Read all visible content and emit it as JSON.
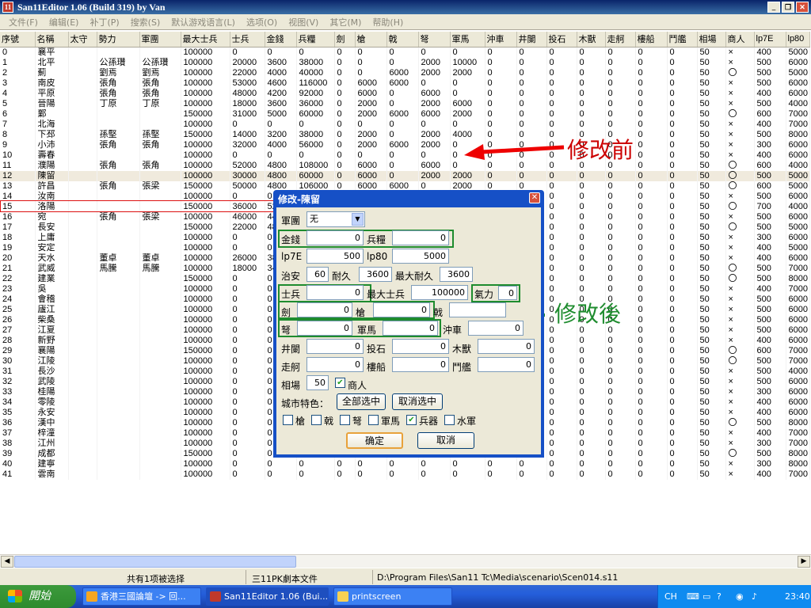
{
  "window": {
    "title": "San11Editor 1.06 (Build 319) by Van",
    "icon": "11"
  },
  "menu": [
    "文件(F)",
    "编辑(E)",
    "补丁(P)",
    "搜索(S)",
    "默认游戏语言(L)",
    "选项(O)",
    "视图(V)",
    "其它(M)",
    "帮助(H)"
  ],
  "columns": [
    "序號",
    "名稱",
    "太守",
    "勢力",
    "軍團",
    "最大士兵",
    "士兵",
    "金錢",
    "兵糧",
    "劍",
    "槍",
    "戟",
    "弩",
    "軍馬",
    "沖車",
    "井闌",
    "投石",
    "木獸",
    "走舸",
    "樓船",
    "鬥艦",
    "相場",
    "商人",
    "lp7E",
    "lp80"
  ],
  "rows": [
    [
      "0",
      "襄平",
      "",
      "",
      "",
      "100000",
      "0",
      "0",
      "0",
      "0",
      "0",
      "0",
      "0",
      "0",
      "0",
      "0",
      "0",
      "0",
      "0",
      "0",
      "0",
      "50",
      "×",
      "400",
      "5000"
    ],
    [
      "1",
      "北平",
      "",
      "公孫瓚",
      "公孫瓚",
      "100000",
      "20000",
      "3600",
      "38000",
      "0",
      "0",
      "0",
      "2000",
      "10000",
      "0",
      "0",
      "0",
      "0",
      "0",
      "0",
      "0",
      "50",
      "×",
      "500",
      "6000"
    ],
    [
      "2",
      "薊",
      "",
      "劉焉",
      "劉焉",
      "100000",
      "22000",
      "4000",
      "40000",
      "0",
      "0",
      "6000",
      "2000",
      "2000",
      "0",
      "0",
      "0",
      "0",
      "0",
      "0",
      "0",
      "50",
      "〇",
      "500",
      "5000"
    ],
    [
      "3",
      "南皮",
      "",
      "張角",
      "張角",
      "100000",
      "53000",
      "4600",
      "116000",
      "0",
      "6000",
      "6000",
      "0",
      "0",
      "0",
      "0",
      "0",
      "0",
      "0",
      "0",
      "0",
      "50",
      "×",
      "500",
      "6000"
    ],
    [
      "4",
      "平原",
      "",
      "張角",
      "張角",
      "100000",
      "48000",
      "4200",
      "92000",
      "0",
      "6000",
      "0",
      "6000",
      "0",
      "0",
      "0",
      "0",
      "0",
      "0",
      "0",
      "0",
      "50",
      "×",
      "400",
      "6000"
    ],
    [
      "5",
      "晉陽",
      "",
      "丁原",
      "丁原",
      "100000",
      "18000",
      "3600",
      "36000",
      "0",
      "2000",
      "0",
      "2000",
      "6000",
      "0",
      "0",
      "0",
      "0",
      "0",
      "0",
      "0",
      "50",
      "×",
      "500",
      "4000"
    ],
    [
      "6",
      "鄴",
      "",
      "",
      "",
      "150000",
      "31000",
      "5000",
      "60000",
      "0",
      "2000",
      "6000",
      "6000",
      "2000",
      "0",
      "0",
      "0",
      "0",
      "0",
      "0",
      "0",
      "50",
      "〇",
      "600",
      "7000"
    ],
    [
      "7",
      "北海",
      "",
      "",
      "",
      "100000",
      "0",
      "0",
      "0",
      "0",
      "0",
      "0",
      "0",
      "0",
      "0",
      "0",
      "0",
      "0",
      "0",
      "0",
      "0",
      "50",
      "×",
      "400",
      "7000"
    ],
    [
      "8",
      "下邳",
      "",
      "孫堅",
      "孫堅",
      "150000",
      "14000",
      "3200",
      "38000",
      "0",
      "2000",
      "0",
      "2000",
      "4000",
      "0",
      "0",
      "0",
      "0",
      "0",
      "0",
      "0",
      "50",
      "×",
      "500",
      "8000"
    ],
    [
      "9",
      "小沛",
      "",
      "張角",
      "張角",
      "100000",
      "32000",
      "4000",
      "56000",
      "0",
      "2000",
      "6000",
      "2000",
      "0",
      "0",
      "0",
      "0",
      "0",
      "0",
      "0",
      "0",
      "50",
      "×",
      "300",
      "6000"
    ],
    [
      "10",
      "壽春",
      "",
      "",
      "",
      "100000",
      "0",
      "0",
      "0",
      "0",
      "0",
      "0",
      "0",
      "0",
      "0",
      "0",
      "0",
      "0",
      "0",
      "0",
      "0",
      "50",
      "×",
      "400",
      "6000"
    ],
    [
      "11",
      "濮陽",
      "",
      "張角",
      "張角",
      "100000",
      "52000",
      "4800",
      "108000",
      "0",
      "6000",
      "0",
      "6000",
      "0",
      "0",
      "0",
      "0",
      "0",
      "0",
      "0",
      "0",
      "50",
      "〇",
      "600",
      "4000"
    ],
    [
      "12",
      "陳留",
      "",
      "",
      "",
      "100000",
      "30000",
      "4800",
      "60000",
      "0",
      "6000",
      "0",
      "2000",
      "2000",
      "0",
      "0",
      "0",
      "0",
      "0",
      "0",
      "0",
      "50",
      "〇",
      "500",
      "5000"
    ],
    [
      "13",
      "許昌",
      "",
      "張角",
      "張梁",
      "150000",
      "50000",
      "4800",
      "106000",
      "0",
      "6000",
      "6000",
      "0",
      "2000",
      "0",
      "0",
      "0",
      "0",
      "0",
      "0",
      "0",
      "50",
      "〇",
      "600",
      "5000"
    ],
    [
      "14",
      "汝南",
      "",
      "",
      "",
      "100000",
      "0",
      "0",
      "0",
      "0",
      "0",
      "0",
      "0",
      "0",
      "0",
      "0",
      "0",
      "0",
      "0",
      "0",
      "0",
      "50",
      "×",
      "500",
      "6000"
    ],
    [
      "15",
      "洛陽",
      "",
      "",
      "",
      "150000",
      "36000",
      "52",
      "",
      "",
      "",
      "",
      "",
      "",
      "0",
      "0",
      "0",
      "0",
      "0",
      "0",
      "0",
      "50",
      "〇",
      "700",
      "4000"
    ],
    [
      "16",
      "宛",
      "",
      "張角",
      "張梁",
      "100000",
      "46000",
      "44",
      "",
      "",
      "",
      "",
      "",
      "",
      "0",
      "0",
      "0",
      "0",
      "0",
      "0",
      "0",
      "50",
      "×",
      "500",
      "6000"
    ],
    [
      "17",
      "長安",
      "",
      "",
      "",
      "150000",
      "22000",
      "48",
      "",
      "",
      "",
      "",
      "",
      "",
      "0",
      "0",
      "0",
      "0",
      "0",
      "0",
      "0",
      "50",
      "〇",
      "500",
      "5000"
    ],
    [
      "18",
      "上庸",
      "",
      "",
      "",
      "100000",
      "0",
      "0",
      "",
      "",
      "",
      "",
      "",
      "",
      "0",
      "0",
      "0",
      "0",
      "0",
      "0",
      "0",
      "50",
      "×",
      "300",
      "6000"
    ],
    [
      "19",
      "安定",
      "",
      "",
      "",
      "100000",
      "0",
      "0",
      "",
      "",
      "",
      "",
      "",
      "",
      "0",
      "0",
      "0",
      "0",
      "0",
      "0",
      "0",
      "50",
      "×",
      "400",
      "5000"
    ],
    [
      "20",
      "天水",
      "",
      "董卓",
      "董卓",
      "100000",
      "26000",
      "38",
      "",
      "",
      "",
      "",
      "",
      "",
      "0",
      "0",
      "0",
      "0",
      "0",
      "0",
      "0",
      "50",
      "×",
      "400",
      "6000"
    ],
    [
      "21",
      "武威",
      "",
      "馬騰",
      "馬騰",
      "100000",
      "18000",
      "34",
      "",
      "",
      "",
      "",
      "",
      "",
      "0",
      "0",
      "0",
      "0",
      "0",
      "0",
      "0",
      "50",
      "〇",
      "500",
      "7000"
    ],
    [
      "22",
      "建業",
      "",
      "",
      "",
      "150000",
      "0",
      "0",
      "",
      "",
      "",
      "",
      "",
      "",
      "0",
      "0",
      "0",
      "0",
      "0",
      "0",
      "0",
      "50",
      "〇",
      "500",
      "8000"
    ],
    [
      "23",
      "吳",
      "",
      "",
      "",
      "100000",
      "0",
      "0",
      "",
      "",
      "",
      "",
      "",
      "",
      "0",
      "0",
      "0",
      "0",
      "0",
      "0",
      "0",
      "50",
      "×",
      "400",
      "7000"
    ],
    [
      "24",
      "會稽",
      "",
      "",
      "",
      "100000",
      "0",
      "0",
      "",
      "",
      "",
      "",
      "",
      "",
      "0",
      "0",
      "0",
      "0",
      "0",
      "0",
      "0",
      "50",
      "×",
      "500",
      "6000"
    ],
    [
      "25",
      "廬江",
      "",
      "",
      "",
      "100000",
      "0",
      "0",
      "",
      "",
      "",
      "",
      "",
      "",
      "0",
      "0",
      "0",
      "0",
      "0",
      "0",
      "0",
      "50",
      "×",
      "500",
      "6000"
    ],
    [
      "26",
      "柴桑",
      "",
      "",
      "",
      "100000",
      "0",
      "0",
      "",
      "",
      "",
      "",
      "",
      "",
      "0",
      "0",
      "0",
      "0",
      "0",
      "0",
      "0",
      "50",
      "×",
      "500",
      "6000"
    ],
    [
      "27",
      "江夏",
      "",
      "",
      "",
      "100000",
      "0",
      "0",
      "",
      "",
      "",
      "",
      "",
      "",
      "0",
      "0",
      "0",
      "0",
      "0",
      "0",
      "0",
      "50",
      "×",
      "500",
      "6000"
    ],
    [
      "28",
      "新野",
      "",
      "",
      "",
      "100000",
      "0",
      "0",
      "",
      "",
      "",
      "",
      "",
      "",
      "0",
      "0",
      "0",
      "0",
      "0",
      "0",
      "0",
      "50",
      "×",
      "400",
      "6000"
    ],
    [
      "29",
      "襄陽",
      "",
      "",
      "",
      "150000",
      "0",
      "0",
      "",
      "",
      "",
      "",
      "",
      "",
      "0",
      "0",
      "0",
      "0",
      "0",
      "0",
      "0",
      "50",
      "〇",
      "600",
      "7000"
    ],
    [
      "30",
      "江陵",
      "",
      "",
      "",
      "100000",
      "0",
      "0",
      "",
      "",
      "",
      "",
      "",
      "",
      "0",
      "0",
      "0",
      "0",
      "0",
      "0",
      "0",
      "50",
      "〇",
      "500",
      "7000"
    ],
    [
      "31",
      "長沙",
      "",
      "",
      "",
      "100000",
      "0",
      "0",
      "",
      "",
      "",
      "",
      "",
      "",
      "0",
      "0",
      "0",
      "0",
      "0",
      "0",
      "0",
      "50",
      "×",
      "500",
      "4000"
    ],
    [
      "32",
      "武陵",
      "",
      "",
      "",
      "100000",
      "0",
      "0",
      "",
      "",
      "",
      "",
      "",
      "",
      "0",
      "0",
      "0",
      "0",
      "0",
      "0",
      "0",
      "50",
      "×",
      "500",
      "6000"
    ],
    [
      "33",
      "桂陽",
      "",
      "",
      "",
      "100000",
      "0",
      "0",
      "",
      "",
      "",
      "",
      "",
      "",
      "0",
      "0",
      "0",
      "0",
      "0",
      "0",
      "0",
      "50",
      "×",
      "300",
      "6000"
    ],
    [
      "34",
      "零陵",
      "",
      "",
      "",
      "100000",
      "0",
      "0",
      "",
      "",
      "",
      "",
      "",
      "",
      "0",
      "0",
      "0",
      "0",
      "0",
      "0",
      "0",
      "50",
      "×",
      "400",
      "6000"
    ],
    [
      "35",
      "永安",
      "",
      "",
      "",
      "100000",
      "0",
      "0",
      "",
      "",
      "",
      "",
      "",
      "",
      "0",
      "0",
      "0",
      "0",
      "0",
      "0",
      "0",
      "50",
      "×",
      "400",
      "6000"
    ],
    [
      "36",
      "漢中",
      "",
      "",
      "",
      "100000",
      "0",
      "0",
      "",
      "",
      "",
      "",
      "",
      "",
      "0",
      "0",
      "0",
      "0",
      "0",
      "0",
      "0",
      "50",
      "〇",
      "500",
      "8000"
    ],
    [
      "37",
      "梓潼",
      "",
      "",
      "",
      "100000",
      "0",
      "0",
      "",
      "",
      "",
      "",
      "",
      "",
      "0",
      "0",
      "0",
      "0",
      "0",
      "0",
      "0",
      "50",
      "×",
      "400",
      "7000"
    ],
    [
      "38",
      "江州",
      "",
      "",
      "",
      "100000",
      "0",
      "0",
      "",
      "",
      "",
      "",
      "",
      "",
      "0",
      "0",
      "0",
      "0",
      "0",
      "0",
      "0",
      "50",
      "×",
      "300",
      "7000"
    ],
    [
      "39",
      "成都",
      "",
      "",
      "",
      "150000",
      "0",
      "0",
      "",
      "",
      "",
      "",
      "",
      "",
      "0",
      "0",
      "0",
      "0",
      "0",
      "0",
      "0",
      "50",
      "〇",
      "500",
      "8000"
    ],
    [
      "40",
      "建寧",
      "",
      "",
      "",
      "100000",
      "0",
      "0",
      "0",
      "0",
      "0",
      "0",
      "0",
      "0",
      "0",
      "0",
      "0",
      "0",
      "0",
      "0",
      "0",
      "50",
      "×",
      "300",
      "8000"
    ],
    [
      "41",
      "雲南",
      "",
      "",
      "",
      "100000",
      "0",
      "0",
      "0",
      "0",
      "0",
      "0",
      "0",
      "0",
      "0",
      "0",
      "0",
      "0",
      "0",
      "0",
      "0",
      "50",
      "×",
      "400",
      "7000"
    ]
  ],
  "selected_row": 12,
  "status": {
    "selection": "共有1项被选择",
    "filetype": "三11PK劇本文件",
    "path": "D:\\Program Files\\San11 Tc\\Media\\scenario\\Scen014.s11"
  },
  "dialog": {
    "title": "修改-陳留",
    "army_label": "軍團",
    "army_value": "无",
    "gold_label": "金錢",
    "gold": "0",
    "food_label": "兵糧",
    "food": "0",
    "lp7e_label": "lp7E",
    "lp7e": "500",
    "lp80_label": "lp80",
    "lp80": "5000",
    "order_label": "治安",
    "order": "60",
    "dur_label": "耐久",
    "dur": "3600",
    "maxdur_label": "最大耐久",
    "maxdur": "3600",
    "troops_label": "士兵",
    "troops": "0",
    "maxtroops_label": "最大士兵",
    "maxtroops": "100000",
    "energy_label": "氣力",
    "energy": "0",
    "sword_label": "劍",
    "sword": "0",
    "spear_label": "槍",
    "spear": "0",
    "halberd_label": "戟",
    "halberd": "",
    "bow_label": "弩",
    "bow": "0",
    "horse_label": "軍馬",
    "horse": "0",
    "ram_label": "沖車",
    "ram": "0",
    "tower_label": "井闌",
    "tower": "0",
    "catapult_label": "投石",
    "catapult": "0",
    "beast_label": "木獸",
    "beast": "0",
    "boat1_label": "走舸",
    "boat1": "0",
    "boat2_label": "樓船",
    "boat2": "0",
    "boat3_label": "鬥艦",
    "boat3": "0",
    "market_label": "相場",
    "market": "50",
    "merchant_label": "商人",
    "feature_label": "城市特色：",
    "select_all": "全部选中",
    "deselect_all": "取消选中",
    "features": [
      "槍",
      "戟",
      "弩",
      "軍馬",
      "兵器",
      "水軍"
    ],
    "ok": "确定",
    "cancel": "取消"
  },
  "annotations": {
    "before": "修改前",
    "after": "修改後"
  },
  "taskbar": {
    "start": "開始",
    "tasks": [
      "香港三國論壇 -> 回...",
      "San11Editor 1.06 (Bui...",
      "printscreen"
    ],
    "lang": "CH",
    "time": "23:40"
  }
}
